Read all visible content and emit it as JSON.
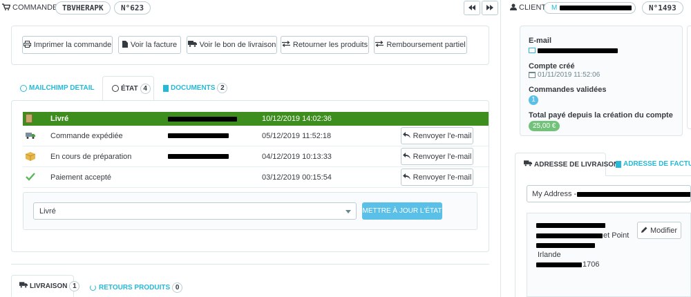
{
  "order": {
    "section_label": "COMMANDE",
    "reference": "TBVHERAPK",
    "number": "N°623",
    "nav_prev_icon": "backward-icon",
    "nav_next_icon": "forward-icon"
  },
  "actions": [
    {
      "label": "Imprimer la commande",
      "icon": "print-icon"
    },
    {
      "label": "Voir la facture",
      "icon": "file-icon"
    },
    {
      "label": "Voir le bon de livraison",
      "icon": "truck-icon"
    },
    {
      "label": "Retourner les produits",
      "icon": "exchange-icon"
    },
    {
      "label": "Remboursement partiel",
      "icon": "exchange-icon"
    }
  ],
  "tabs": [
    {
      "label": "MAILCHIMP DETAIL",
      "count": ""
    },
    {
      "label": "ÉTAT",
      "count": "4"
    },
    {
      "label": "DOCUMENTS",
      "count": "2"
    }
  ],
  "history": [
    {
      "label": "Livré",
      "date": "10/12/2019 14:02:36",
      "highlight": true
    },
    {
      "label": "Commande expédiée",
      "date": "05/12/2019 11:52:18",
      "resend": "Renvoyer l'e-mail"
    },
    {
      "label": "En cours de préparation",
      "date": "04/12/2019 10:13:33",
      "resend": "Renvoyer l'e-mail"
    },
    {
      "label": "Paiement accepté",
      "date": "03/12/2019 00:15:54",
      "resend": "Renvoyer l'e-mail"
    }
  ],
  "status_form": {
    "selected": "Livré",
    "submit": "METTRE À JOUR L'ÉTAT"
  },
  "bottom_tabs": [
    {
      "label": "LIVRAISON",
      "count": "1"
    },
    {
      "label": "RETOURS PRODUITS",
      "count": "0"
    }
  ],
  "client": {
    "section_label": "CLIENT",
    "initial": "M",
    "number": "N°1493",
    "email_label": "E-mail",
    "account_created_label": "Compte créé",
    "account_created": "01/11/2019 11:52:06",
    "orders_validated_label": "Commandes validées",
    "orders_validated": "1",
    "total_paid_label": "Total payé depuis la création du compte",
    "total_paid": "25,00 €"
  },
  "address": {
    "tab_delivery": "ADRESSE DE LIVRAISON",
    "tab_invoice": "ADRESSE DE FACTURATIO",
    "select_prefix": "My Address -",
    "line_point": "et Point",
    "country": "Irlande",
    "phone_suffix": "1706",
    "modify": "Modifier"
  },
  "colors": {
    "accent": "#25b9d7",
    "delivered_green": "#3e8e1e",
    "submit_blue": "#5bc0e8",
    "paid_green": "#72c279"
  }
}
